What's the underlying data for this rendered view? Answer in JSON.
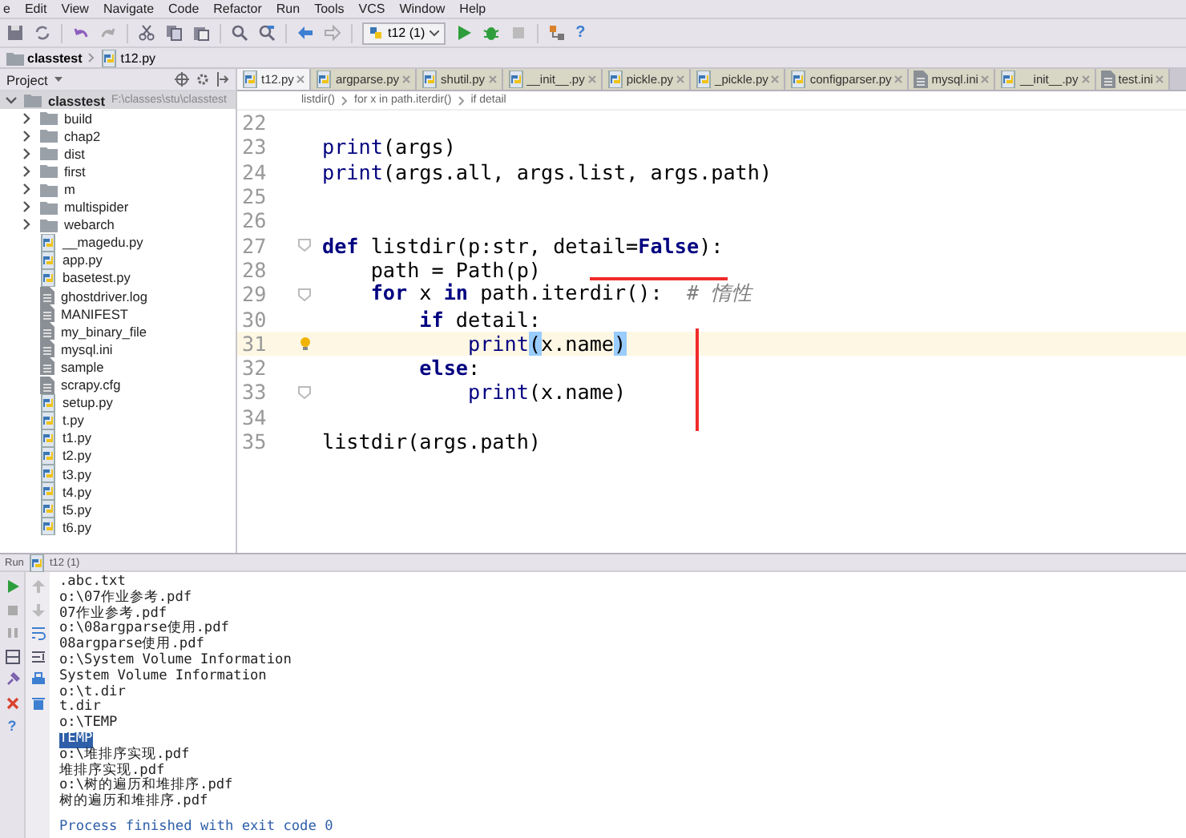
{
  "menu": [
    "e",
    "Edit",
    "View",
    "Navigate",
    "Code",
    "Refactor",
    "Run",
    "Tools",
    "VCS",
    "Window",
    "Help"
  ],
  "toolbar": {
    "run_config": "t12 (1)",
    "help": "?"
  },
  "navbar": [
    "classtest",
    "t12.py"
  ],
  "project": {
    "title": "Project",
    "root": {
      "label": "classtest",
      "path": "F:\\classes\\stu\\classtest",
      "expanded": true,
      "selected": true,
      "children": [
        {
          "label": "build",
          "kind": "folder",
          "expanded": false,
          "selected": false
        },
        {
          "label": "chap2",
          "kind": "folder",
          "expanded": false,
          "selected": false
        },
        {
          "label": "dist",
          "kind": "folder",
          "expanded": false,
          "selected": false
        },
        {
          "label": "first",
          "kind": "folder",
          "expanded": false,
          "selected": false
        },
        {
          "label": "m",
          "kind": "folder",
          "expanded": false,
          "selected": false
        },
        {
          "label": "multispider",
          "kind": "folder",
          "expanded": false,
          "selected": false
        },
        {
          "label": "webarch",
          "kind": "folder",
          "expanded": false,
          "selected": false
        },
        {
          "label": "__magedu.py",
          "kind": "py",
          "selected": false
        },
        {
          "label": "app.py",
          "kind": "py",
          "selected": false
        },
        {
          "label": "basetest.py",
          "kind": "py",
          "selected": false
        },
        {
          "label": "ghostdriver.log",
          "kind": "file",
          "selected": false
        },
        {
          "label": "MANIFEST",
          "kind": "file",
          "selected": false
        },
        {
          "label": "my_binary_file",
          "kind": "file",
          "selected": false
        },
        {
          "label": "mysql.ini",
          "kind": "file",
          "selected": false
        },
        {
          "label": "sample",
          "kind": "file",
          "selected": false
        },
        {
          "label": "scrapy.cfg",
          "kind": "file",
          "selected": false
        },
        {
          "label": "setup.py",
          "kind": "py",
          "selected": false
        },
        {
          "label": "t.py",
          "kind": "py",
          "selected": false
        },
        {
          "label": "t1.py",
          "kind": "py",
          "selected": false
        },
        {
          "label": "t2.py",
          "kind": "py",
          "selected": false
        },
        {
          "label": "t3.py",
          "kind": "py",
          "selected": false
        },
        {
          "label": "t4.py",
          "kind": "py",
          "selected": false
        },
        {
          "label": "t5.py",
          "kind": "py",
          "selected": false
        },
        {
          "label": "t6.py",
          "kind": "py",
          "selected": false
        }
      ]
    }
  },
  "tabs": [
    {
      "label": "t12.py",
      "kind": "py",
      "selected": true
    },
    {
      "label": "argparse.py",
      "kind": "py",
      "selected": false
    },
    {
      "label": "shutil.py",
      "kind": "py",
      "selected": false
    },
    {
      "label": "__init__.py",
      "kind": "py",
      "selected": false
    },
    {
      "label": "pickle.py",
      "kind": "py",
      "selected": false
    },
    {
      "label": "_pickle.py",
      "kind": "py",
      "selected": false
    },
    {
      "label": "configparser.py",
      "kind": "py",
      "selected": false
    },
    {
      "label": "mysql.ini",
      "kind": "file",
      "selected": false
    },
    {
      "label": "__init__.py",
      "kind": "py",
      "selected": false
    },
    {
      "label": "test.ini",
      "kind": "file",
      "selected": false
    }
  ],
  "editor_breadcrumb": [
    "listdir()",
    "for x in path.iterdir()",
    "if detail"
  ],
  "code": [
    {
      "number": "22",
      "current": false,
      "foldable": false,
      "bulb": false
    },
    {
      "number": "23",
      "current": false,
      "foldable": false,
      "bulb": false,
      "tokens": [
        {
          "text": "print",
          "kind": "builtin"
        },
        {
          "text": "(args)",
          "kind": "plain"
        }
      ]
    },
    {
      "number": "24",
      "current": false,
      "foldable": false,
      "bulb": false,
      "tokens": [
        {
          "text": "print",
          "kind": "builtin"
        },
        {
          "text": "(args.all, args.list, args.path)",
          "kind": "plain"
        }
      ]
    },
    {
      "number": "25",
      "current": false,
      "foldable": false,
      "bulb": false
    },
    {
      "number": "26",
      "current": false,
      "foldable": false,
      "bulb": false
    },
    {
      "number": "27",
      "current": false,
      "foldable": true,
      "bulb": false,
      "tokens": [
        {
          "text": "def",
          "kind": "keyword"
        },
        {
          "text": " listdir(p:str, detail=",
          "kind": "plain"
        },
        {
          "text": "False",
          "kind": "keyword"
        },
        {
          "text": "):",
          "kind": "plain"
        }
      ]
    },
    {
      "number": "28",
      "current": false,
      "foldable": false,
      "bulb": false,
      "tokens": [
        {
          "text": "    path = Path(p)",
          "kind": "plain"
        }
      ]
    },
    {
      "number": "29",
      "current": false,
      "foldable": true,
      "bulb": false,
      "tokens": [
        {
          "text": "    for",
          "kind": "keyword"
        },
        {
          "text": " x ",
          "kind": "plain"
        },
        {
          "text": "in",
          "kind": "keyword"
        },
        {
          "text": " path.iterdir():  ",
          "kind": "plain"
        },
        {
          "text": "# 惰性",
          "kind": "comment"
        }
      ]
    },
    {
      "number": "30",
      "current": false,
      "foldable": false,
      "bulb": false,
      "tokens": [
        {
          "text": "        if",
          "kind": "keyword"
        },
        {
          "text": " detail:",
          "kind": "plain"
        }
      ]
    },
    {
      "number": "31",
      "current": true,
      "foldable": false,
      "bulb": true,
      "tokens": [
        {
          "text": "            print",
          "kind": "builtin"
        },
        {
          "text": "(",
          "kind": "match"
        },
        {
          "text": "x.name",
          "kind": "plain"
        },
        {
          "text": ")",
          "kind": "match"
        }
      ]
    },
    {
      "number": "32",
      "current": false,
      "foldable": false,
      "bulb": false,
      "tokens": [
        {
          "text": "        else",
          "kind": "keyword"
        },
        {
          "text": ":",
          "kind": "plain"
        }
      ]
    },
    {
      "number": "33",
      "current": false,
      "foldable": true,
      "bulb": false,
      "tokens": [
        {
          "text": "            print",
          "kind": "builtin"
        },
        {
          "text": "(x.name)",
          "kind": "plain"
        }
      ]
    },
    {
      "number": "34",
      "current": false,
      "foldable": false,
      "bulb": false
    },
    {
      "number": "35",
      "current": false,
      "foldable": false,
      "bulb": false,
      "tokens": [
        {
          "text": "listdir(args.path)",
          "kind": "plain"
        }
      ]
    }
  ],
  "run": {
    "title": "Run",
    "config": "t12 (1)",
    "help": "?",
    "output": [
      {
        "text": ".abc.txt",
        "selected": false
      },
      {
        "text": "o:\\07作业参考.pdf",
        "selected": false
      },
      {
        "text": "07作业参考.pdf",
        "selected": false
      },
      {
        "text": "o:\\08argparse使用.pdf",
        "selected": false
      },
      {
        "text": "08argparse使用.pdf",
        "selected": false
      },
      {
        "text": "o:\\System Volume Information",
        "selected": false
      },
      {
        "text": "System Volume Information",
        "selected": false
      },
      {
        "text": "o:\\t.dir",
        "selected": false
      },
      {
        "text": "t.dir",
        "selected": false
      },
      {
        "text": "o:\\TEMP",
        "selected": false
      },
      {
        "text": "TEMP",
        "selected": true
      },
      {
        "text": "o:\\堆排序实现.pdf",
        "selected": false
      },
      {
        "text": "堆排序实现.pdf",
        "selected": false
      },
      {
        "text": "o:\\树的遍历和堆排序.pdf",
        "selected": false
      },
      {
        "text": "树的遍历和堆排序.pdf",
        "selected": false
      }
    ],
    "status": "Process finished with exit code 0"
  }
}
